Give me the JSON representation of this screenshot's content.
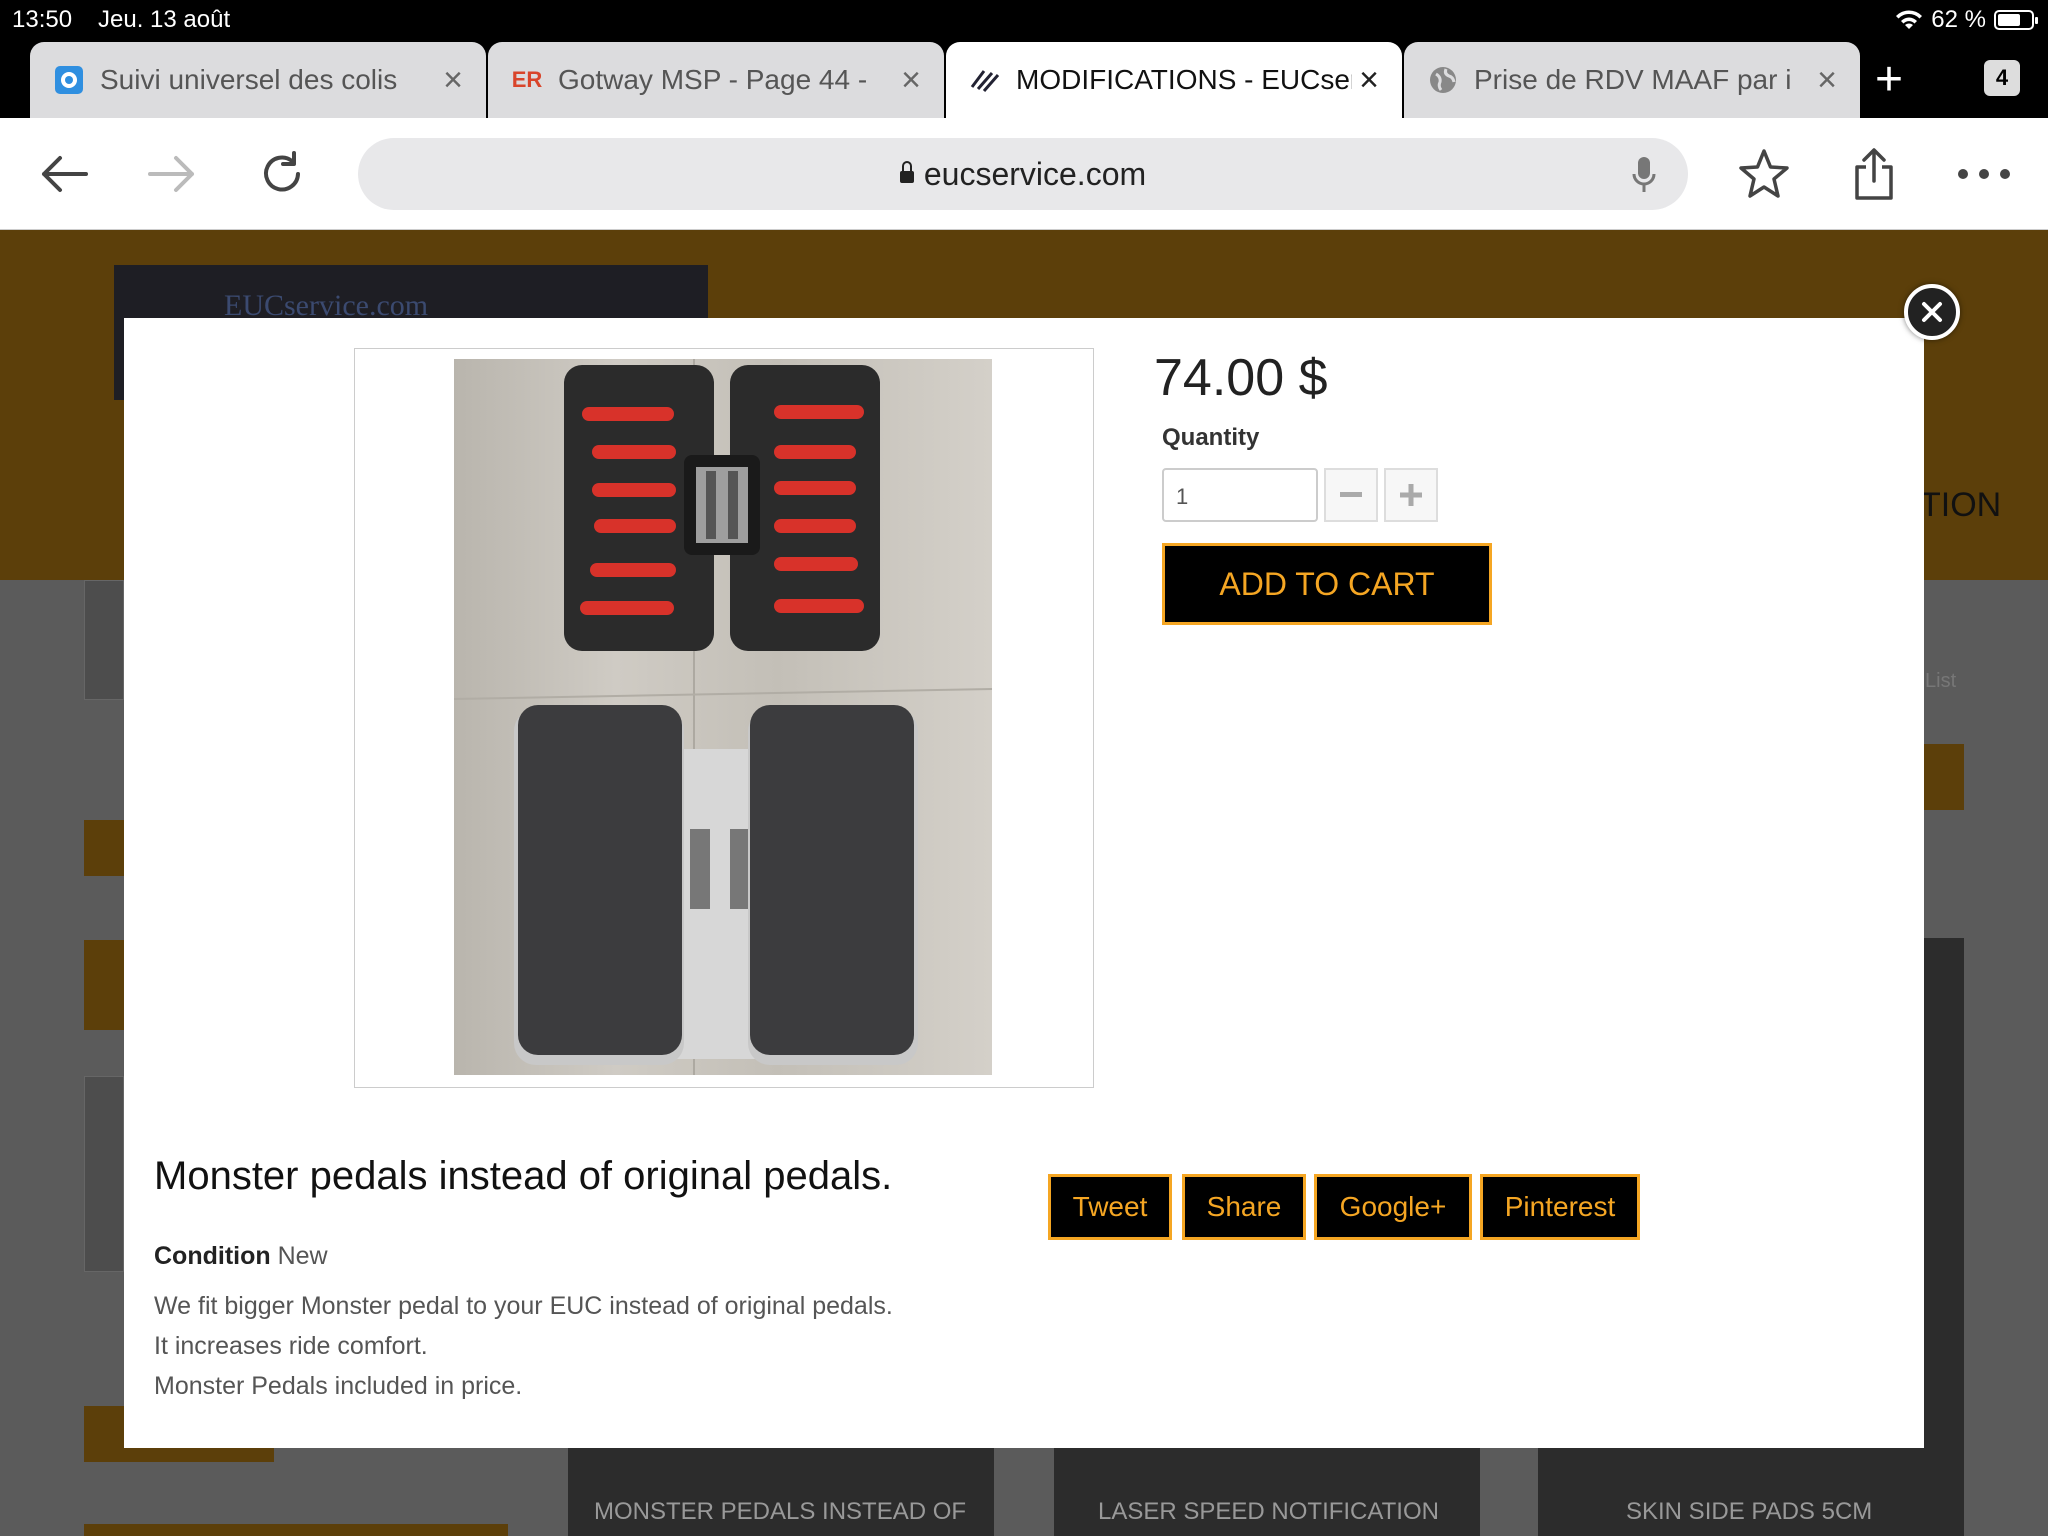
{
  "status": {
    "time": "13:50",
    "date": "Jeu. 13 août",
    "battery": "62 %"
  },
  "tabs": [
    {
      "title": "Suivi universel des colis",
      "favicon": ""
    },
    {
      "title": "Gotway MSP - Page 44 -",
      "favicon": "ER"
    },
    {
      "title": "MODIFICATIONS - EUCservice",
      "favicon": ""
    },
    {
      "title": "Prise de RDV MAAF par i",
      "favicon": ""
    }
  ],
  "tab_count": "4",
  "address": {
    "url": "eucservice.com"
  },
  "site": {
    "logo_text": "EUCservice.com",
    "nav_fragment": "TION",
    "list_label": "List",
    "products": [
      "MONSTER PEDALS INSTEAD OF",
      "LASER SPEED NOTIFICATION",
      "SKIN SIDE PADS 5CM"
    ]
  },
  "modal": {
    "price": "74.00 $",
    "quantity_label": "Quantity",
    "quantity_value": "1",
    "add_to_cart": "ADD TO CART",
    "product_name": "Monster pedals instead of original pedals.",
    "condition_label": "Condition",
    "condition_value": "New",
    "description": [
      "We fit bigger Monster pedal to your EUC instead of original pedals.",
      "It increases ride comfort.",
      "Monster Pedals included in price."
    ],
    "share": {
      "tweet": "Tweet",
      "share": "Share",
      "google": "Google+",
      "pinterest": "Pinterest"
    }
  }
}
